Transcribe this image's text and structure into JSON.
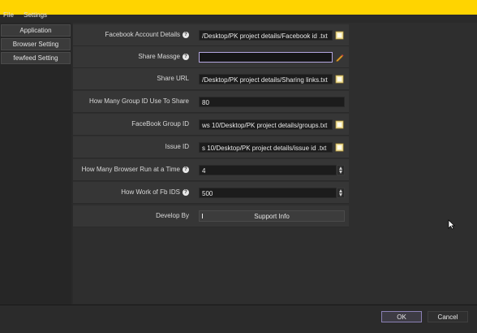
{
  "menu": {
    "file": "File",
    "settings": "Settings"
  },
  "sidebar": {
    "items": [
      {
        "label": "Application"
      },
      {
        "label": "Browser Setting"
      },
      {
        "label": "fewfeed Setting"
      }
    ]
  },
  "form": {
    "facebook_account": {
      "label": "Facebook Account Details",
      "value": "/Desktop/PK project details/Facebook id .txt"
    },
    "share_message": {
      "label": "Share Massge",
      "value": ""
    },
    "share_url": {
      "label": "Share URL",
      "value": "/Desktop/PK project details/Sharing links.txt"
    },
    "group_id_count": {
      "label": "How Many Group ID Use To Share",
      "value": "80"
    },
    "facebook_group_id": {
      "label": "FaceBook Group ID",
      "value": "ws 10/Desktop/PK project details/groups.txt"
    },
    "issue_id": {
      "label": "Issue ID",
      "value": "s 10/Desktop/PK project details/issue id .txt"
    },
    "browser_count": {
      "label": "How Many Browser Run at a Time",
      "value": "4"
    },
    "fb_ids_work": {
      "label": "How Work of Fb IDS",
      "value": "500"
    },
    "develop_by": {
      "label": "Develop By",
      "button": "Support Info"
    }
  },
  "footer": {
    "ok": "OK",
    "cancel": "Cancel"
  },
  "colors": {
    "accent": "#ffd400",
    "focus": "#b4a6e0",
    "background": "#2a2a2a"
  },
  "icons": [
    "help-icon",
    "folder-icon",
    "pencil-icon",
    "spin-up-icon",
    "spin-down-icon",
    "mouse-cursor-icon"
  ]
}
